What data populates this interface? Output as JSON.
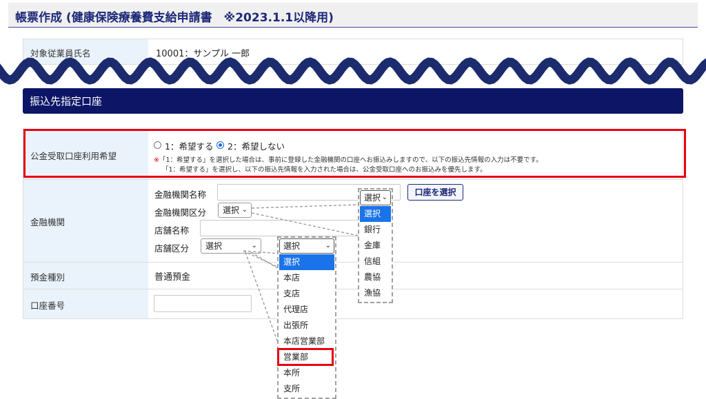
{
  "header": {
    "title": "帳票作成 (健康保険療養費支給申請書　※2023.1.1以降用)"
  },
  "employee": {
    "label": "対象従業員氏名",
    "value": "10001：サンプル 一郎"
  },
  "section": {
    "title": "振込先指定口座"
  },
  "public_account": {
    "label": "公金受取口座利用希望",
    "option1": "1：希望する",
    "option2": "2：希望しない",
    "selected": "2",
    "note_mark": "※",
    "note_line1": "「1：希望する」を選択した場合は、事前に登録した金融機関の口座へお振込みしますので、以下の振込先情報の入力は不要です。",
    "note_line2": "「1：希望する」を選択し、以下の振込先情報を入力された場合は、公金受取口座へのお振込みを優先します。"
  },
  "bank": {
    "label": "金融機関",
    "name_label": "金融機関名称",
    "type_label": "金融機関区分",
    "type_value": "選択",
    "branch_name_label": "店舗名称",
    "branch_type_label": "店舗区分",
    "branch_type_value": "選択",
    "select_account_button": "口座を選択"
  },
  "bank_type_dropdown": {
    "value": "選択",
    "options": [
      "選択",
      "銀行",
      "金庫",
      "信組",
      "農協",
      "漁協"
    ],
    "highlighted": 0
  },
  "branch_type_dropdown": {
    "value": "選択",
    "options": [
      "選択",
      "本店",
      "支店",
      "代理店",
      "出張所",
      "本店営業部",
      "営業部",
      "本所",
      "支所"
    ],
    "highlighted": 0,
    "callout": 6
  },
  "deposit": {
    "label": "預金種別",
    "value": "普通預金"
  },
  "account_number": {
    "label": "口座番号",
    "value": ""
  },
  "colors": {
    "accent_navy": "#0d1566",
    "callout_red": "#e60012",
    "select_blue": "#1a73e8"
  }
}
